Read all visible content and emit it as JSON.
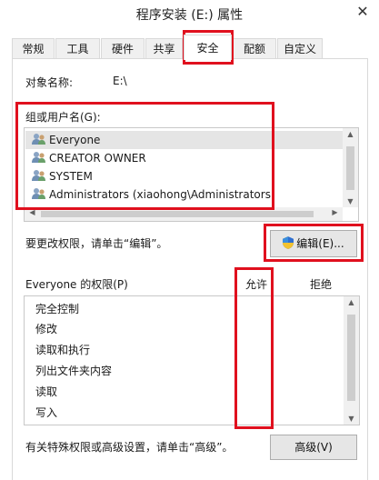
{
  "window": {
    "title": "程序安装 (E:) 属性",
    "close_glyph": "✕"
  },
  "tabs": [
    {
      "label": "常规"
    },
    {
      "label": "工具"
    },
    {
      "label": "硬件"
    },
    {
      "label": "共享"
    },
    {
      "label": "安全",
      "active": true
    },
    {
      "label": "配额"
    },
    {
      "label": "自定义"
    }
  ],
  "object_name": {
    "label": "对象名称:",
    "value": "E:\\"
  },
  "groups": {
    "label": "组或用户名(G):",
    "items": [
      {
        "name": "Everyone",
        "icon": "users-icon"
      },
      {
        "name": "CREATOR OWNER",
        "icon": "users-icon"
      },
      {
        "name": "SYSTEM",
        "icon": "users-icon"
      },
      {
        "name": "Administrators (xiaohong\\Administrators)",
        "icon": "users-icon"
      }
    ]
  },
  "edit_hint": "要更改权限，请单击“编辑”。",
  "edit_button": {
    "label": "编辑(E)...",
    "icon": "uac-shield-icon"
  },
  "permissions": {
    "title": "Everyone 的权限(P)",
    "allow_header": "允许",
    "deny_header": "拒绝",
    "rows": [
      "完全控制",
      "修改",
      "读取和执行",
      "列出文件夹内容",
      "读取",
      "写入"
    ]
  },
  "advanced_hint": "有关特殊权限或高级设置，请单击“高级”。",
  "advanced_button": {
    "label": "高级(V)"
  },
  "colors": {
    "highlight": "#e0101e",
    "selected_row": "#e5e5e5",
    "scrollbar": "#f0f0f0"
  }
}
